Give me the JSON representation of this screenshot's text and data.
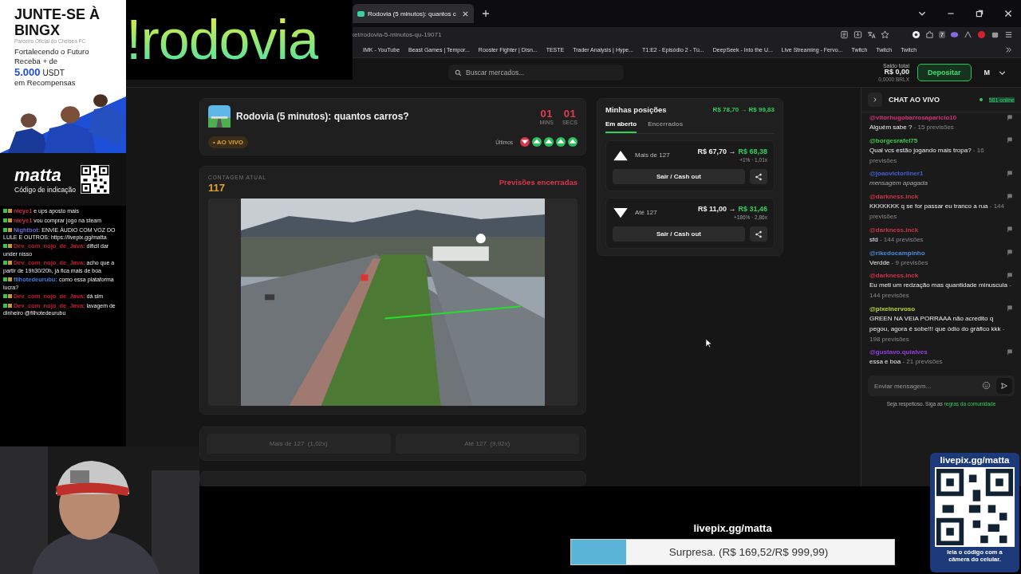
{
  "browser": {
    "tab": {
      "title": "Rodovia (5 minutos): quantos c",
      "selected": true
    },
    "address": "ket/rodovia-5-minutos-qu-19071",
    "extension_badge": "7",
    "bookmarks": [
      "IMK - YouTube",
      "Beast Games | Tempor...",
      "Rooster Fighter | Disn...",
      "TESTE",
      "Trader Analysis | Hype...",
      "T1:E2 - Episódio 2 - Tú...",
      "DeepSeek - Into the U...",
      "Live Streaming - Fervo...",
      "Twitch",
      "Twitch",
      "Twitch"
    ]
  },
  "header": {
    "search": {
      "placeholder": "Buscar mercados..."
    },
    "balance_label": "Saldo total",
    "balance": "R$ 0,00",
    "balance_sub": "0,0000 BRLX",
    "deposit": "Depositar",
    "avatar": "M"
  },
  "market": {
    "title": "Rodovia (5 minutos): quantos carros?",
    "timer": [
      {
        "value": "01",
        "unit": "MINS"
      },
      {
        "value": "01",
        "unit": "SECS"
      }
    ],
    "live": "• AO VIVO",
    "recent_label": "Últimos",
    "recent": [
      {
        "kind": "down"
      },
      {
        "kind": "up"
      },
      {
        "kind": "up"
      },
      {
        "kind": "up"
      },
      {
        "kind": "up"
      }
    ]
  },
  "count": {
    "label": "CONTAGEM ATUAL",
    "value": "117",
    "status": "Previsões encerradas"
  },
  "options": [
    {
      "label": "Mais de 127  (1,02x)",
      "disabled": true
    },
    {
      "label": "Até 127  (9,92x)",
      "disabled": true
    }
  ],
  "positions": {
    "title": "Minhas posições",
    "total": "R$ 78,70 → R$ 99,83",
    "tabs": [
      {
        "label": "Em aberto",
        "selected": true
      },
      {
        "label": "Encerrados",
        "selected": false
      }
    ],
    "items": [
      {
        "kind": "up",
        "label": "Mais de 127",
        "from": "R$ 67,70 →",
        "to": "R$ 68,38",
        "change": "+1% · 1,01x",
        "action": "Sair / Cash out"
      },
      {
        "kind": "down",
        "label": "Até 127",
        "from": "R$ 11,00 →",
        "to": "R$ 31,46",
        "change": "+186% · 2,86x",
        "action": "Sair / Cash out"
      }
    ]
  },
  "chat": {
    "title": "CHAT AO VIVO",
    "online": "581 online",
    "messages": [
      {
        "kind": "text",
        "user": "@vitorhugobarrosaparicio10",
        "color": "#d0307a",
        "text": "Alguém sabe ?",
        "count": "- 15 previsões"
      },
      {
        "kind": "text",
        "user": "@borgesrafel75",
        "color": "#3cc94a",
        "text": "Qual vcs estão jogando mais tropa?",
        "count": "- 16 previsões"
      },
      {
        "kind": "deleted",
        "user": "@joaovictorliner1",
        "color": "#4a5fd0",
        "text": "mensagem apagada"
      },
      {
        "kind": "text",
        "user": "@darkness.inck",
        "color": "#d0304a",
        "text": "KKKKKKK q se for passar eu tranco a rua",
        "count": "- 144 previsões"
      },
      {
        "kind": "text",
        "user": "@darkness.inck",
        "color": "#d0304a",
        "text": "sfd",
        "count": "- 144 previsões"
      },
      {
        "kind": "text",
        "user": "@rikedocampinho",
        "color": "#4a8ad8",
        "text": "Verdde",
        "count": "- 9 previsões"
      },
      {
        "kind": "text",
        "user": "@darkness.inck",
        "color": "#d0304a",
        "text": "Eu meti um redzação mas quantidade minuscula",
        "count": "- 144 previsões"
      },
      {
        "kind": "text",
        "user": "@pixelnervoso",
        "color": "#b8d830",
        "text": "GREEN NA VEIA PORRAAA não acredito q pegou, agora é sobe!!! que ódio do gráfico kkk",
        "count": "- 198 previsões"
      },
      {
        "kind": "text",
        "user": "@gustavo.quialves",
        "color": "#9040d8",
        "text": "essa e boa",
        "count": "- 21 previsões"
      }
    ],
    "input": {
      "placeholder": "Enviar mensagem..."
    },
    "rules_text": "Seja respeitoso. Siga as",
    "rules_link": "regras da comunidade"
  },
  "overlay": {
    "command": "!rodovia",
    "ad": {
      "headline": "JUNTE-SE À BINGX",
      "partner": "Parceiro Oficial do Chelsea FC",
      "line1": "Fortalecendo o Futuro",
      "line2": "Receba + de",
      "amount": "5.000",
      "currency": "USDT",
      "line3": "em Recompensas",
      "code": "matta",
      "code_label": "Código de indicação"
    },
    "stream_chat": [
      {
        "user": "nieye1",
        "color": "#d03050",
        "text": "e ups aposto mais"
      },
      {
        "user": "nieye1",
        "color": "#d03050",
        "text": "vou comprar jogo na steam"
      },
      {
        "user": "Nightbot:",
        "color": "#6a6ae0",
        "text": "ENVIE ÁUDIO COM VOZ DO LULE E OUTROS: https://livepix.gg/matta"
      },
      {
        "user": "Dev_com_nojo_de_Java:",
        "color": "#c02030",
        "text": "dificil dar under nisso"
      },
      {
        "user": "Dev_com_nojo_de_Java:",
        "color": "#c02030",
        "text": "acho que a partir de 19h30/20h, já fica mais de boa"
      },
      {
        "user": "filhotedeurubu:",
        "color": "#3a80e0",
        "text": "como essa plataforma lucra?"
      },
      {
        "user": "Dev_com_nojo_de_Java:",
        "color": "#c02030",
        "text": "dá sim"
      },
      {
        "user": "Dev_com_nojo_de_Java:",
        "color": "#c02030",
        "text": "lavagem de dinheiro @filhotedeurubu"
      }
    ],
    "donation": {
      "url": "livepix.gg/matta",
      "goal": "Surpresa. (R$ 169,52/R$ 999,99)",
      "level": 0.17
    },
    "qr": {
      "url": "livepix.gg/matta",
      "caption": "leia o código com a câmera do celular."
    }
  }
}
